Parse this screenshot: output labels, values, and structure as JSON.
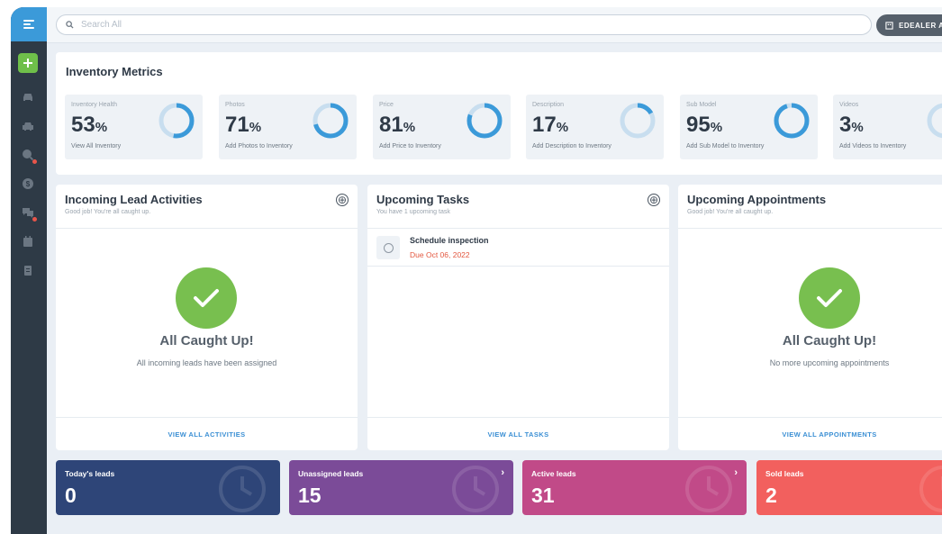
{
  "sidebar": {
    "items": [
      {
        "icon": "car-icon"
      },
      {
        "icon": "car-front-icon"
      },
      {
        "icon": "search-car-icon",
        "badge": true
      },
      {
        "icon": "dollar-icon"
      },
      {
        "icon": "chat-icon",
        "badge": true
      },
      {
        "icon": "calendar-icon"
      },
      {
        "icon": "clipboard-icon"
      }
    ],
    "add_label": "+"
  },
  "topbar": {
    "search_placeholder": "Search All",
    "dealer_button": "EDEALER AU"
  },
  "metrics": {
    "title": "Inventory Metrics",
    "cards": [
      {
        "label": "Inventory Health",
        "value": "53",
        "unit": "%",
        "link": "View All Inventory",
        "percent": 53
      },
      {
        "label": "Photos",
        "value": "71",
        "unit": "%",
        "link": "Add Photos to Inventory",
        "percent": 71
      },
      {
        "label": "Price",
        "value": "81",
        "unit": "%",
        "link": "Add Price to Inventory",
        "percent": 81
      },
      {
        "label": "Description",
        "value": "17",
        "unit": "%",
        "link": "Add Description to Inventory",
        "percent": 17
      },
      {
        "label": "Sub Model",
        "value": "95",
        "unit": "%",
        "link": "Add Sub Model to Inventory",
        "percent": 95
      },
      {
        "label": "Videos",
        "value": "3",
        "unit": "%",
        "link": "Add Videos to Inventory",
        "percent": 3
      }
    ]
  },
  "panels": {
    "leads": {
      "title": "Incoming Lead Activities",
      "subtitle": "Good job! You're all caught up.",
      "add_icon": "⊕",
      "empty_title": "All Caught Up!",
      "empty_desc": "All incoming leads have been assigned",
      "footer": "VIEW ALL ACTIVITIES"
    },
    "tasks": {
      "title": "Upcoming Tasks",
      "subtitle": "You have 1 upcoming task",
      "add_icon": "⊕",
      "items": [
        {
          "name": "Schedule inspection",
          "due": "Due Oct 06, 2022"
        }
      ],
      "footer": "VIEW ALL TASKS"
    },
    "appointments": {
      "title": "Upcoming Appointments",
      "subtitle": "Good job! You're all caught up.",
      "empty_title": "All Caught Up!",
      "empty_desc": "No more upcoming appointments",
      "footer": "VIEW ALL APPOINTMENTS"
    }
  },
  "lead_tiles": [
    {
      "label": "Today's leads",
      "count": "0",
      "color": "#2e4578",
      "arrow": ""
    },
    {
      "label": "Unassigned leads",
      "count": "15",
      "color": "#7b4b98",
      "arrow": "›"
    },
    {
      "label": "Active leads",
      "count": "31",
      "color": "#c14a88",
      "arrow": "›"
    },
    {
      "label": "Sold leads",
      "count": "2",
      "color": "#f2605e",
      "arrow": ""
    }
  ],
  "colors": {
    "ring_fill": "#3b9ad9",
    "ring_track": "#c8deef",
    "accent": "#3b8fd4",
    "success": "#78bf4f",
    "due": "#e3573f"
  }
}
